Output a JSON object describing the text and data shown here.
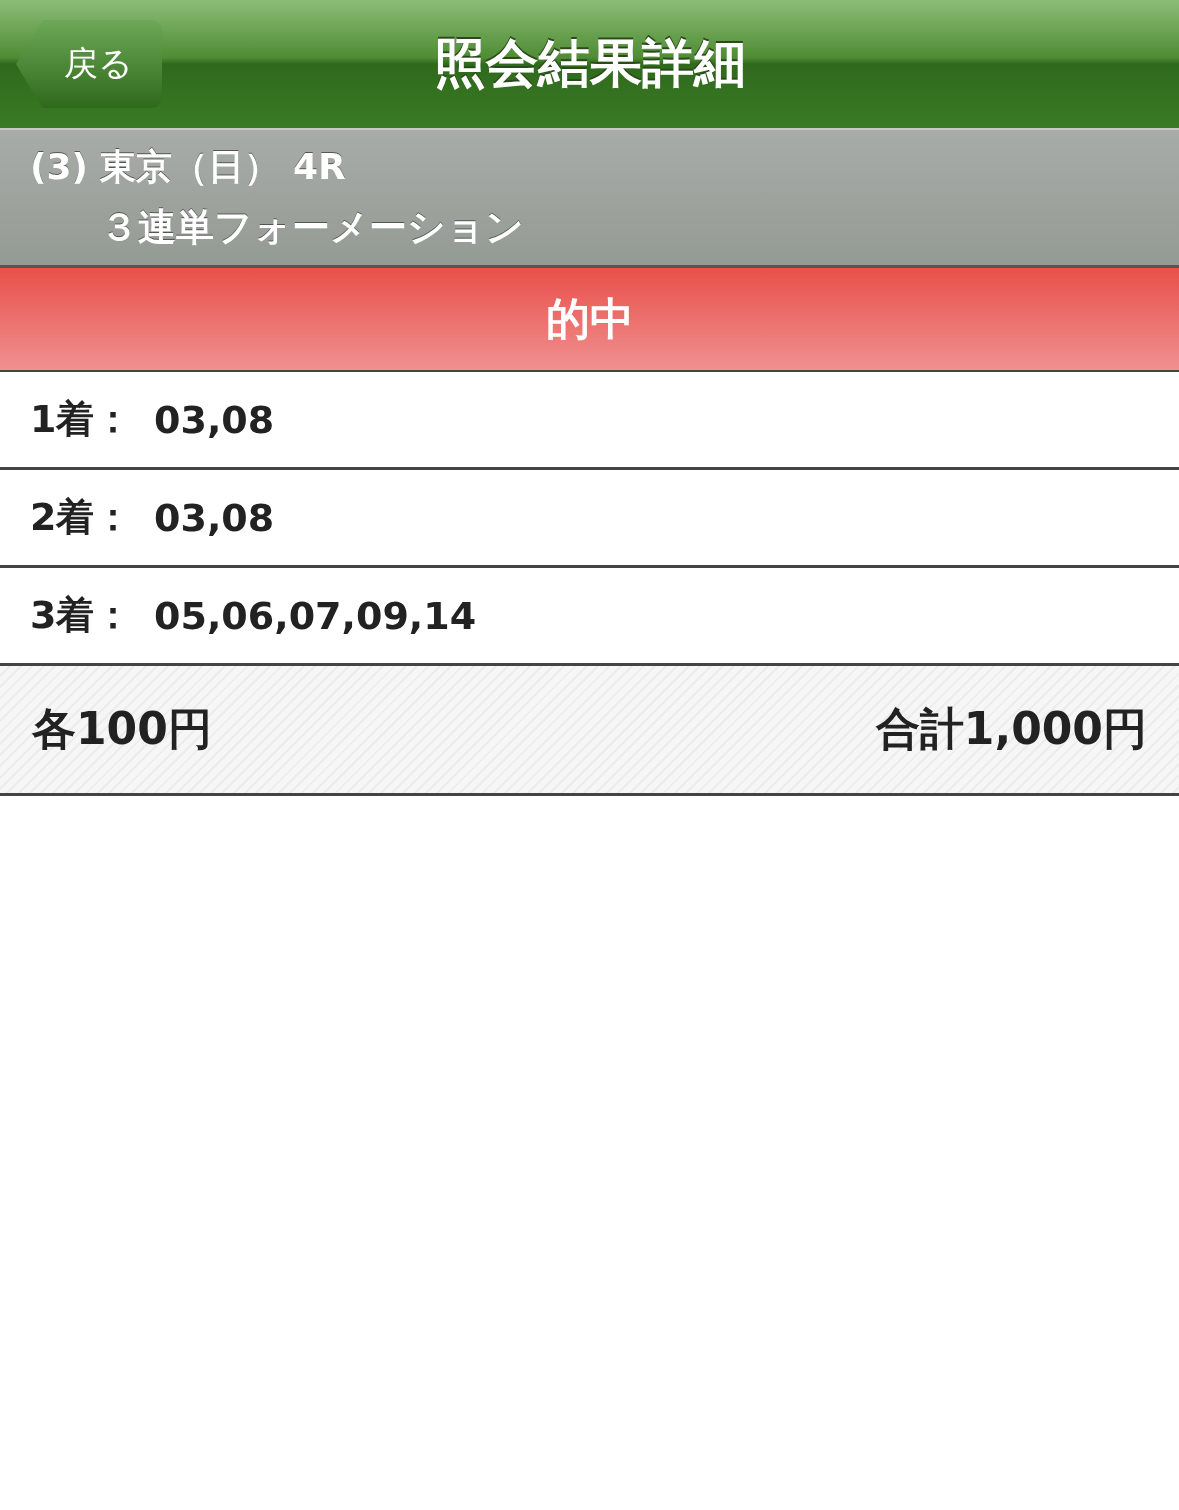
{
  "nav": {
    "back": "戻る",
    "title": "照会結果詳細"
  },
  "race": {
    "venue": "(3) 東京（日） 4R",
    "bet_type": "３連単フォーメーション"
  },
  "result": {
    "label": "的中"
  },
  "rows": [
    {
      "label": "1着：",
      "value": "03,08"
    },
    {
      "label": "2着：",
      "value": "03,08"
    },
    {
      "label": "3着：",
      "value": "05,06,07,09,14"
    }
  ],
  "footer": {
    "unit": "各100円",
    "total": "合計1,000円"
  }
}
